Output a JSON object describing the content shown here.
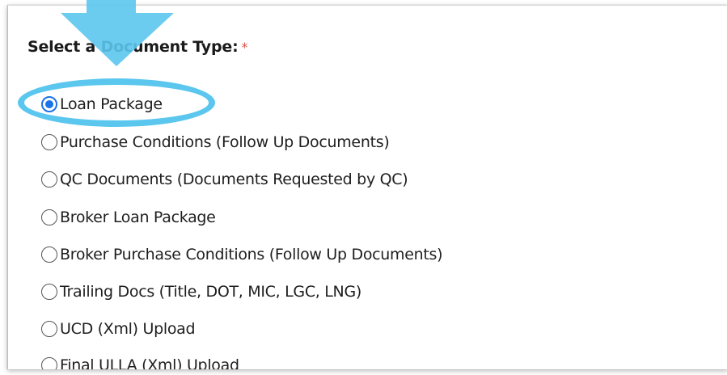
{
  "heading": "Select a Document Type:",
  "required_mark": "*",
  "options": [
    {
      "label": "Loan Package",
      "checked": true
    },
    {
      "label": "Purchase Conditions (Follow Up Documents)",
      "checked": false
    },
    {
      "label": "QC Documents (Documents Requested by QC)",
      "checked": false
    },
    {
      "label": "Broker Loan Package",
      "checked": false
    },
    {
      "label": "Broker Purchase Conditions (Follow Up Documents)",
      "checked": false
    },
    {
      "label": "Trailing Docs (Title, DOT, MIC, LGC, LNG)",
      "checked": false
    },
    {
      "label": "UCD (Xml) Upload",
      "checked": false
    },
    {
      "label": "Final ULLA (Xml) Upload",
      "checked": false
    }
  ],
  "annotation": {
    "arrow_color": "#5bc7ee",
    "highlight_color": "#5bc7ee",
    "icon": "down-arrow-icon"
  }
}
